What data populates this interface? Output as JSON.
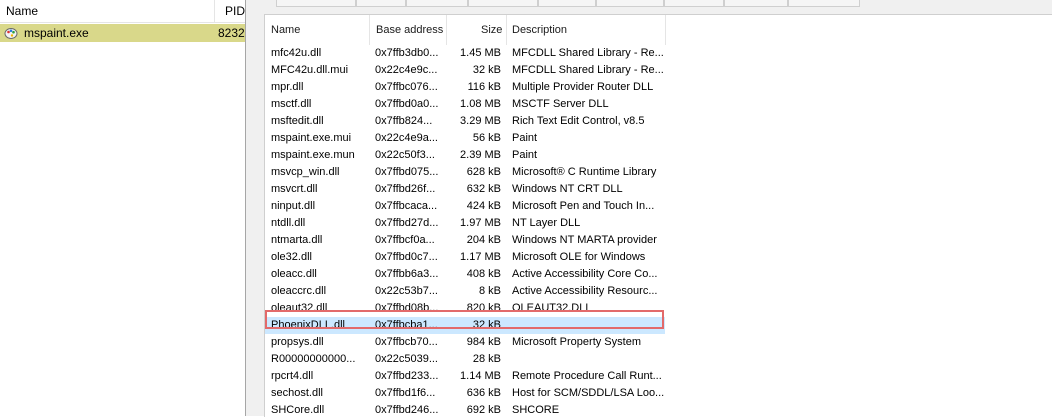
{
  "background": {
    "columns": {
      "name": "Name",
      "pid": "PID"
    },
    "process": {
      "name": "mspaint.exe",
      "pid": "8232"
    }
  },
  "modules": {
    "columns": {
      "name": "Name",
      "base": "Base address",
      "size": "Size",
      "description": "Description"
    },
    "rows": [
      {
        "name": "mfc42u.dll",
        "base": "0x7ffb3db0...",
        "size": "1.45 MB",
        "description": "MFCDLL Shared Library - Re..."
      },
      {
        "name": "MFC42u.dll.mui",
        "base": "0x22c4e9c...",
        "size": "32 kB",
        "description": "MFCDLL Shared Library - Re..."
      },
      {
        "name": "mpr.dll",
        "base": "0x7ffbc076...",
        "size": "116 kB",
        "description": "Multiple Provider Router DLL"
      },
      {
        "name": "msctf.dll",
        "base": "0x7ffbd0a0...",
        "size": "1.08 MB",
        "description": "MSCTF Server DLL"
      },
      {
        "name": "msftedit.dll",
        "base": "0x7ffb824...",
        "size": "3.29 MB",
        "description": "Rich Text Edit Control, v8.5"
      },
      {
        "name": "mspaint.exe.mui",
        "base": "0x22c4e9a...",
        "size": "56 kB",
        "description": "Paint"
      },
      {
        "name": "mspaint.exe.mun",
        "base": "0x22c50f3...",
        "size": "2.39 MB",
        "description": "Paint"
      },
      {
        "name": "msvcp_win.dll",
        "base": "0x7ffbd075...",
        "size": "628 kB",
        "description": "Microsoft® C Runtime Library"
      },
      {
        "name": "msvcrt.dll",
        "base": "0x7ffbd26f...",
        "size": "632 kB",
        "description": "Windows NT CRT DLL"
      },
      {
        "name": "ninput.dll",
        "base": "0x7ffbcaca...",
        "size": "424 kB",
        "description": "Microsoft Pen and Touch In..."
      },
      {
        "name": "ntdll.dll",
        "base": "0x7ffbd27d...",
        "size": "1.97 MB",
        "description": "NT Layer DLL"
      },
      {
        "name": "ntmarta.dll",
        "base": "0x7ffbcf0a...",
        "size": "204 kB",
        "description": "Windows NT MARTA provider"
      },
      {
        "name": "ole32.dll",
        "base": "0x7ffbd0c7...",
        "size": "1.17 MB",
        "description": "Microsoft OLE for Windows"
      },
      {
        "name": "oleacc.dll",
        "base": "0x7ffbb6a3...",
        "size": "408 kB",
        "description": "Active Accessibility Core Co..."
      },
      {
        "name": "oleaccrc.dll",
        "base": "0x22c53b7...",
        "size": "8 kB",
        "description": "Active Accessibility Resourc..."
      },
      {
        "name": "oleaut32.dll",
        "base": "0x7ffbd08b...",
        "size": "820 kB",
        "description": "OLEAUT32.DLL"
      },
      {
        "name": "PhoenixDLL.dll",
        "base": "0x7ffbcba1...",
        "size": "32 kB",
        "description": ""
      },
      {
        "name": "propsys.dll",
        "base": "0x7ffbcb70...",
        "size": "984 kB",
        "description": "Microsoft Property System"
      },
      {
        "name": "R00000000000...",
        "base": "0x22c5039...",
        "size": "28 kB",
        "description": ""
      },
      {
        "name": "rpcrt4.dll",
        "base": "0x7ffbd233...",
        "size": "1.14 MB",
        "description": "Remote Procedure Call Runt..."
      },
      {
        "name": "sechost.dll",
        "base": "0x7ffbd1f6...",
        "size": "636 kB",
        "description": "Host for SCM/SDDL/LSA Loo..."
      },
      {
        "name": "SHCore.dll",
        "base": "0x7ffbd246...",
        "size": "692 kB",
        "description": "SHCORE"
      }
    ],
    "selected_index": 16
  },
  "colors": {
    "process_row_bg": "#d9d88a",
    "selected_row_bg": "#cce8ff",
    "highlight_border": "#e26a6a"
  }
}
